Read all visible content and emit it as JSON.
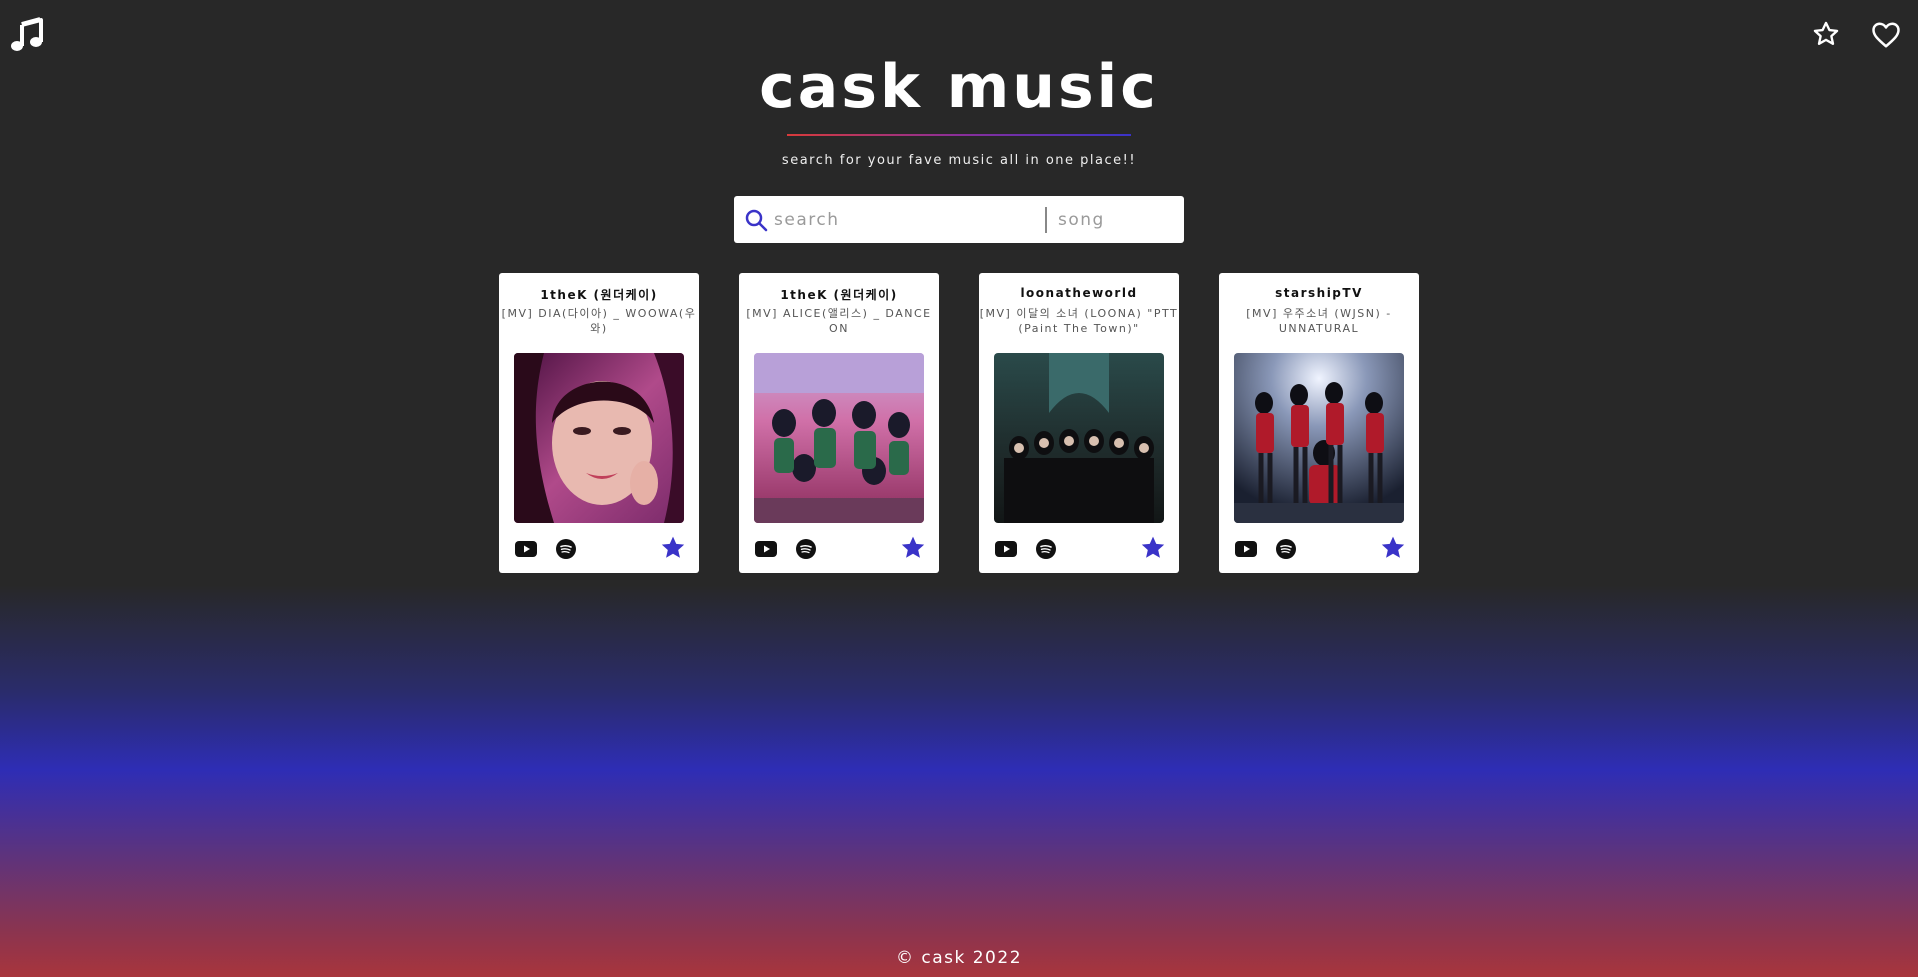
{
  "header": {
    "title": "cask music",
    "subtitle": "search for your fave music all in one place!!"
  },
  "search": {
    "placeholder": "search",
    "value": "",
    "type_selected": "song"
  },
  "cards": [
    {
      "channel": "1theK (원더케이)",
      "title": "[MV] DIA(다이아) _ WOOWA(우와)"
    },
    {
      "channel": "1theK (원더케이)",
      "title": "[MV] ALICE(앨리스) _ DANCE ON"
    },
    {
      "channel": "loonatheworld",
      "title": "[MV] 이달의 소녀 (LOONA) \"PTT (Paint The Town)\""
    },
    {
      "channel": "starshipTV",
      "title": "[MV] 우주소녀 (WJSN) - UNNATURAL"
    }
  ],
  "footer": {
    "text": "© cask 2022"
  },
  "colors": {
    "accent": "#3a33c8",
    "background": "#282828",
    "gradient_bottom": "#a8353c"
  }
}
